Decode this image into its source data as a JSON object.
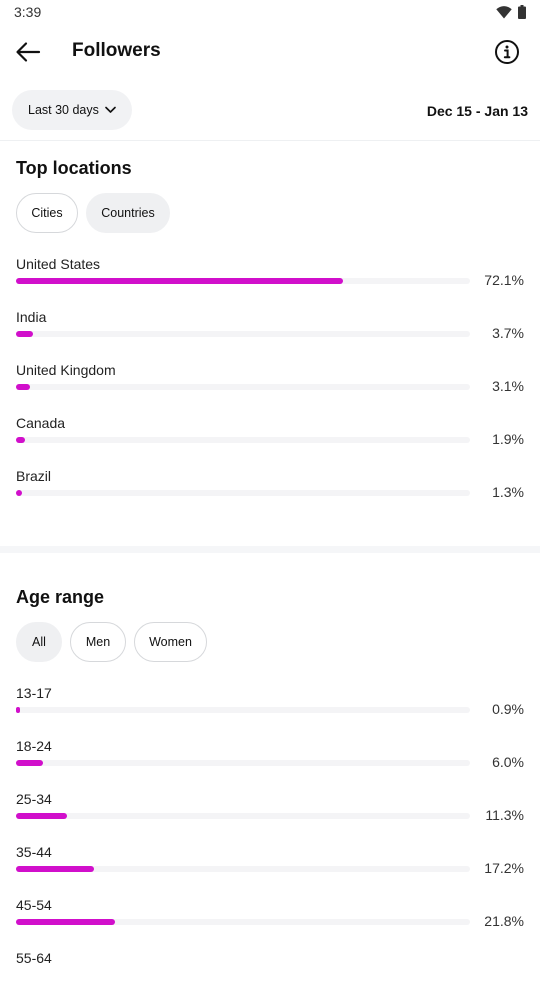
{
  "status_bar": {
    "time": "3:39"
  },
  "header": {
    "title": "Followers"
  },
  "filter": {
    "range_label": "Last 30 days",
    "date_range": "Dec 15 - Jan 13"
  },
  "locations": {
    "title": "Top locations",
    "tabs": [
      "Cities",
      "Countries"
    ],
    "selected_tab": "Countries",
    "items": [
      {
        "label": "United States",
        "value": 72.1,
        "display": "72.1%"
      },
      {
        "label": "India",
        "value": 3.7,
        "display": "3.7%"
      },
      {
        "label": "United Kingdom",
        "value": 3.1,
        "display": "3.1%"
      },
      {
        "label": "Canada",
        "value": 1.9,
        "display": "1.9%"
      },
      {
        "label": "Brazil",
        "value": 1.3,
        "display": "1.3%"
      }
    ]
  },
  "age": {
    "title": "Age range",
    "tabs": [
      "All",
      "Men",
      "Women"
    ],
    "selected_tab": "All",
    "items": [
      {
        "label": "13-17",
        "value": 0.9,
        "display": "0.9%"
      },
      {
        "label": "18-24",
        "value": 6.0,
        "display": "6.0%"
      },
      {
        "label": "25-34",
        "value": 11.3,
        "display": "11.3%"
      },
      {
        "label": "35-44",
        "value": 17.2,
        "display": "17.2%"
      },
      {
        "label": "45-54",
        "value": 21.8,
        "display": "21.8%"
      },
      {
        "label": "55-64",
        "value": null,
        "display": ""
      }
    ]
  },
  "colors": {
    "bar": "#d10fcb",
    "track": "#f4f4f6"
  }
}
